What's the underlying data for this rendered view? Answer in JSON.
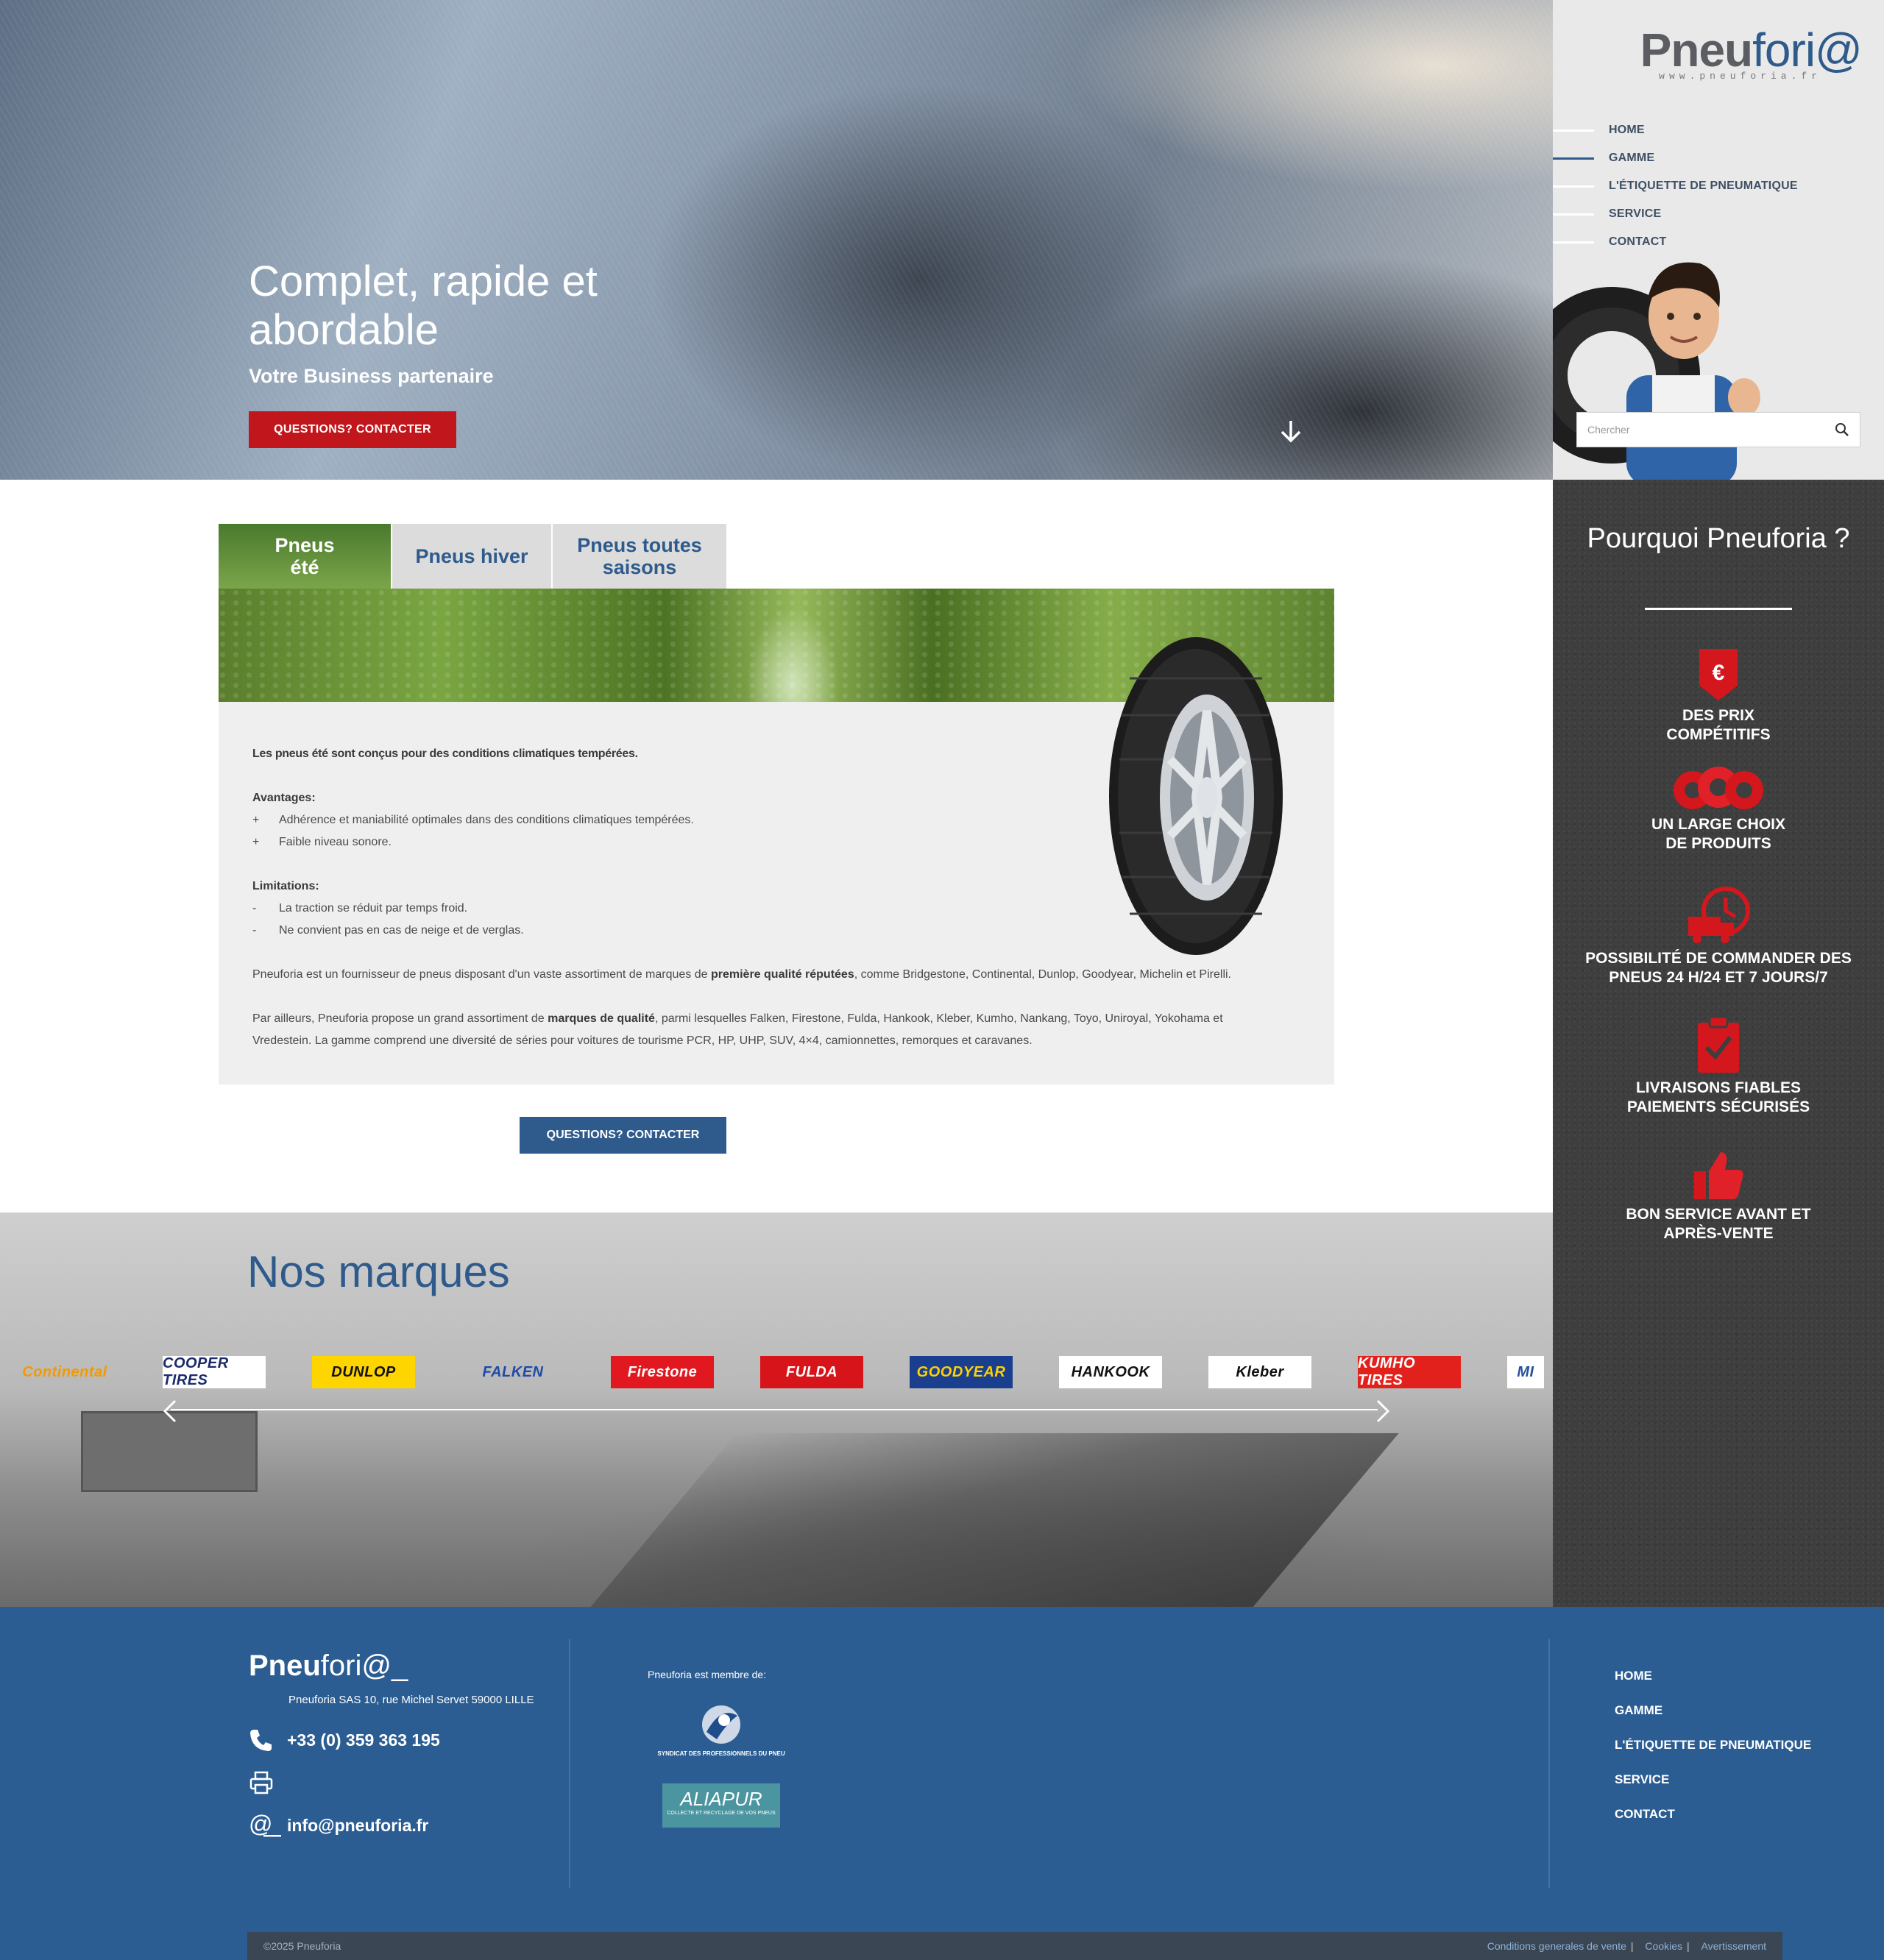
{
  "hero": {
    "title": "Complet, rapide et abordable",
    "subtitle": "Votre Business partenaire",
    "cta": "QUESTIONS? CONTACTER"
  },
  "header": {
    "logo_bold": "Pneu",
    "logo_light": "fori@",
    "logo_url": "www.pneuforia.fr",
    "nav": [
      {
        "label": "HOME",
        "active": false
      },
      {
        "label": "GAMME",
        "active": true
      },
      {
        "label": "L'ÉTIQUETTE DE PNEUMATIQUE",
        "active": false
      },
      {
        "label": "SERVICE",
        "active": false
      },
      {
        "label": "CONTACT",
        "active": false
      }
    ],
    "search_placeholder": "Chercher"
  },
  "why": {
    "title": "Pourquoi Pneuforia ?",
    "features": [
      {
        "icon": "euro-shield-icon",
        "label": "DES PRIX COMPÉTITIFS"
      },
      {
        "icon": "tires-icon",
        "label": "UN LARGE CHOIX DE PRODUITS"
      },
      {
        "icon": "delivery-clock-icon",
        "label": "POSSIBILITÉ DE COMMANDER DES PNEUS 24 H/24 ET 7 JOURS/7"
      },
      {
        "icon": "clipboard-check-icon",
        "label": "LIVRAISONS FIABLES PAIEMENTS SÉCURISÉS"
      },
      {
        "icon": "thumbs-up-icon",
        "label": "BON SERVICE AVANT ET APRÈS-VENTE"
      }
    ],
    "accent_color": "#c0161c"
  },
  "tabs": [
    {
      "label": "Pneus été",
      "active": true
    },
    {
      "label": "Pneus hiver",
      "active": false
    },
    {
      "label": "Pneus toutes saisons",
      "active": false
    }
  ],
  "content": {
    "intro": "Les pneus été sont conçus pour des conditions climatiques tempérées.",
    "advantages_title": "Avantages:",
    "advantages": [
      "Adhérence et maniabilité optimales dans des conditions climatiques tempérées.",
      "Faible niveau sonore."
    ],
    "limitations_title": "Limitations:",
    "limitations": [
      "La traction se réduit par temps froid.",
      "Ne convient pas en cas de neige et de verglas."
    ],
    "para1_a": "Pneuforia est un fournisseur de pneus disposant d'un vaste assortiment de marques de ",
    "para1_b": "première qualité réputées",
    "para1_c": ", comme Bridgestone, Continental, Dunlop, Goodyear, Michelin et Pirelli.",
    "para2_a": "Par ailleurs, Pneuforia propose un grand assortiment de ",
    "para2_b": "marques de qualité",
    "para2_c": ", parmi lesquelles  Falken, Firestone, Fulda, Hankook, Kleber, Kumho, Nankang, Toyo, Uniroyal, Yokohama et Vredestein. La gamme comprend une diversité de séries pour voitures de tourisme PCR, HP, UHP, SUV, 4×4, camionnettes, remorques et caravanes.",
    "cta": "QUESTIONS? CONTACTER"
  },
  "brands": {
    "title": "Nos marques",
    "logos": [
      {
        "name": "Continental",
        "bg": "transparent",
        "fg": "#f29a00"
      },
      {
        "name": "COOPER TIRES",
        "bg": "#ffffff",
        "fg": "#1b2a6b"
      },
      {
        "name": "DUNLOP",
        "bg": "#ffd500",
        "fg": "#111111"
      },
      {
        "name": "FALKEN",
        "bg": "transparent",
        "fg": "#1f4aa8"
      },
      {
        "name": "Firestone",
        "bg": "#e1181f",
        "fg": "#ffffff"
      },
      {
        "name": "FULDA",
        "bg": "#d8141b",
        "fg": "#ffffff"
      },
      {
        "name": "GOODYEAR",
        "bg": "#1a3f8f",
        "fg": "#ffd100"
      },
      {
        "name": "HANKOOK",
        "bg": "#ffffff",
        "fg": "#111111"
      },
      {
        "name": "Kleber",
        "bg": "#ffffff",
        "fg": "#111111"
      },
      {
        "name": "KUMHO TIRES",
        "bg": "#e3211c",
        "fg": "#ffffff"
      },
      {
        "name": "MI",
        "bg": "#ffffff",
        "fg": "#27509b"
      }
    ]
  },
  "footer": {
    "logo_bold": "Pneu",
    "logo_light": "fori@_",
    "address": "Pneuforia SAS 10, rue Michel Servet 59000 LILLE",
    "phone": "+33 (0) 359 363 195",
    "email": "info@pneuforia.fr",
    "member_label": "Pneuforia est membre de:",
    "partner1_caption": "SYNDICAT DES PROFESSIONNELS DU PNEU",
    "partner2_name": "ALIAPUR",
    "partner2_caption": "COLLECTE ET RECYCLAGE DE VOS PNEUS",
    "nav": [
      "HOME",
      "GAMME",
      "L'ÉTIQUETTE DE PNEUMATIQUE",
      "SERVICE",
      "CONTACT"
    ],
    "copyright": "©2025 Pneuforia",
    "links": [
      "Conditions generales de vente",
      "Cookies",
      "Avertissement"
    ]
  }
}
